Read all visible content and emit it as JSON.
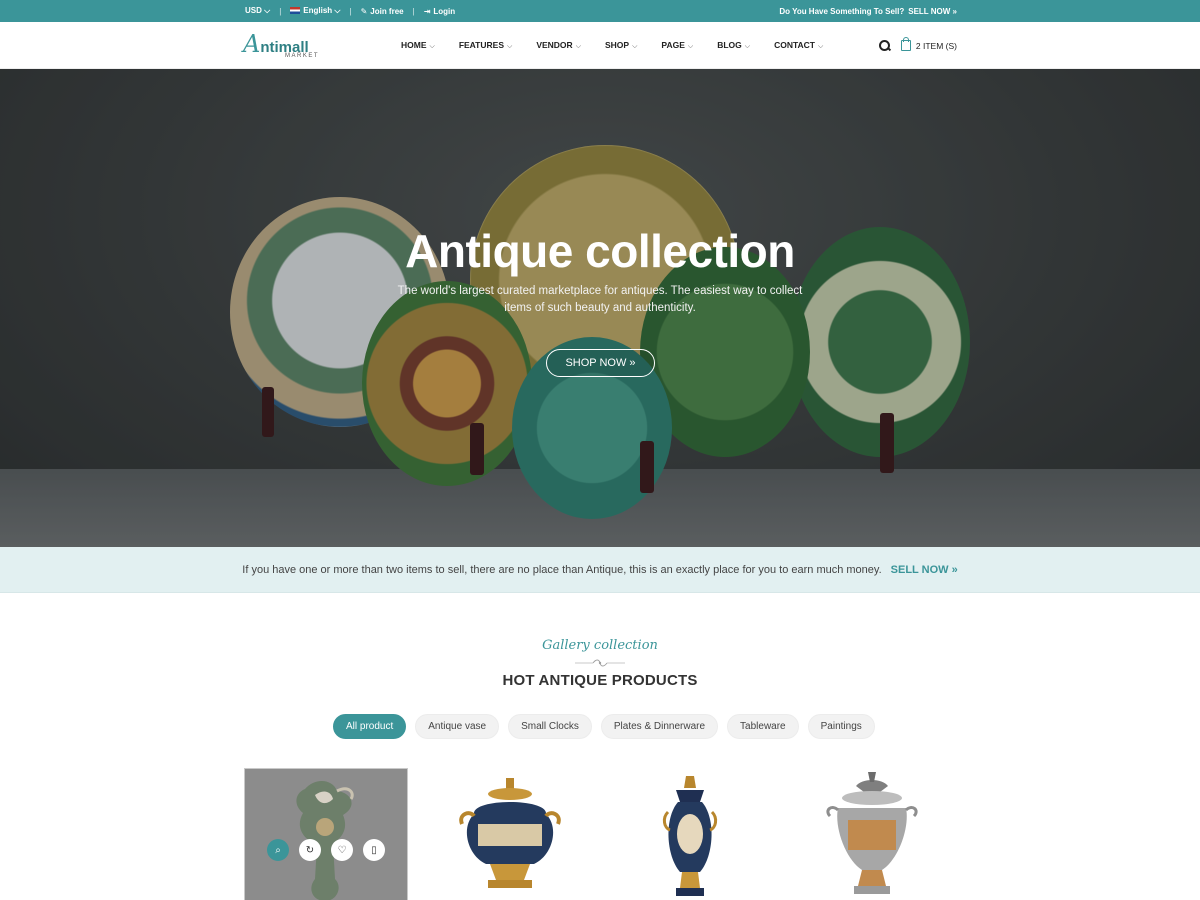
{
  "topbar": {
    "currency": "USD",
    "language": "English",
    "join": "Join free",
    "login": "Login",
    "sell_prompt": "Do You Have Something To Sell?",
    "sell_now": "SELL NOW"
  },
  "header": {
    "logo_main": "ntimall",
    "logo_initial": "A",
    "logo_sub": "MARKET",
    "nav": [
      "HOME",
      "FEATURES",
      "VENDOR",
      "SHOP",
      "PAGE",
      "BLOG",
      "CONTACT"
    ],
    "cart": "2 ITEM (S)"
  },
  "hero": {
    "title": "Antique collection",
    "subtitle": "The world's largest curated marketplace for antiques. The easiest way to collect items of such beauty and authenticity.",
    "button": "SHOP NOW"
  },
  "sellstrip": {
    "text": "If you have one or more than two items to sell, there are no place than Antique, this is an exactly place for you to earn much money.",
    "link": "SELL NOW"
  },
  "gallery": {
    "kicker": "Gallery collection",
    "title": "HOT ANTIQUE PRODUCTS",
    "filters": [
      "All product",
      "Antique vase",
      "Small Clocks",
      "Plates & Dinnerware",
      "Tableware",
      "Paintings"
    ],
    "active_filter": "All product"
  },
  "products": [
    {
      "icon": "ewer-vase-image"
    },
    {
      "icon": "gilt-urn-image"
    },
    {
      "icon": "tall-urn-image"
    },
    {
      "icon": "silver-urn-image"
    }
  ],
  "colors": {
    "accent": "#3b9599",
    "topbar": "#3b9599",
    "strip": "#e2f0f1"
  }
}
